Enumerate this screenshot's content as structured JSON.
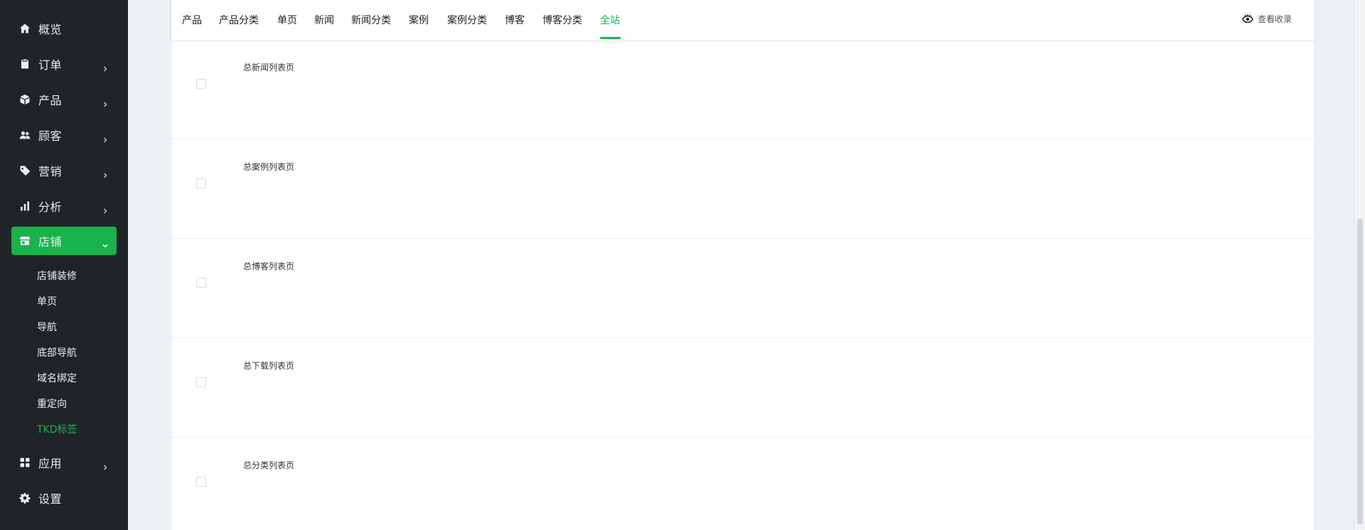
{
  "sidebar": {
    "items": [
      {
        "label": "概览",
        "icon": "home-icon"
      },
      {
        "label": "订单",
        "icon": "clipboard-icon"
      },
      {
        "label": "产品",
        "icon": "box-icon"
      },
      {
        "label": "顾客",
        "icon": "users-icon"
      },
      {
        "label": "营销",
        "icon": "tag-icon"
      },
      {
        "label": "分析",
        "icon": "bar-chart-icon"
      },
      {
        "label": "店铺",
        "icon": "store-icon"
      },
      {
        "label": "应用",
        "icon": "apps-icon"
      },
      {
        "label": "设置",
        "icon": "gear-icon"
      }
    ],
    "store_sub_items": [
      {
        "label": "店铺装修"
      },
      {
        "label": "单页"
      },
      {
        "label": "导航"
      },
      {
        "label": "底部导航"
      },
      {
        "label": "域名绑定"
      },
      {
        "label": "重定向"
      },
      {
        "label": "TKD标签"
      }
    ],
    "active_item": "店铺",
    "active_sub_item": "TKD标签"
  },
  "tabs": [
    {
      "label": "产品"
    },
    {
      "label": "产品分类"
    },
    {
      "label": "单页"
    },
    {
      "label": "新闻"
    },
    {
      "label": "新闻分类"
    },
    {
      "label": "案例"
    },
    {
      "label": "案例分类"
    },
    {
      "label": "博客"
    },
    {
      "label": "博客分类"
    },
    {
      "label": "全站"
    }
  ],
  "active_tab": "全站",
  "header": {
    "view_index_label": "查看收录",
    "view_index_icon": "eye-icon"
  },
  "rows": [
    {
      "title": "总新闻列表页"
    },
    {
      "title": "总案例列表页"
    },
    {
      "title": "总博客列表页"
    },
    {
      "title": "总下载列表页"
    },
    {
      "title": "总分类列表页"
    }
  ],
  "colors": {
    "accent": "#19b34b",
    "sidebar_bg": "#202428",
    "page_bg": "#eef1f4"
  }
}
